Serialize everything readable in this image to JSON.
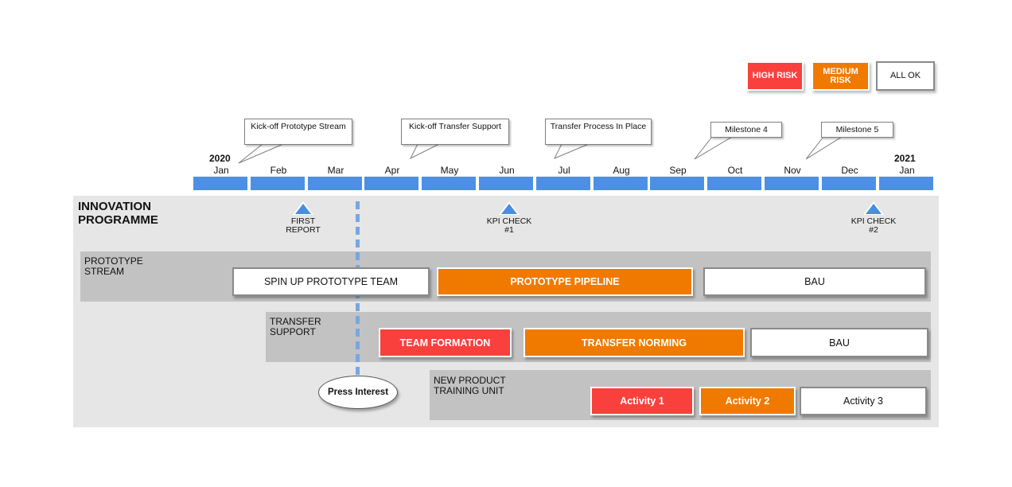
{
  "legend": {
    "high_risk": "HIGH RISK",
    "medium_risk": "MEDIUM RISK",
    "all_ok": "ALL OK",
    "colors": {
      "high": "#f9403c",
      "medium": "#f07a00",
      "ok": "#ffffff",
      "timeline": "#4f8fe3",
      "milestone": "#4a8ee0"
    }
  },
  "callouts": [
    {
      "text": "Kick-off Prototype Stream",
      "month": "Jan"
    },
    {
      "text": "Kick-off Transfer Support",
      "month": "Apr"
    },
    {
      "text": "Transfer Process In Place",
      "month": "Jul"
    },
    {
      "text": "Milestone 4",
      "month": "Sep"
    },
    {
      "text": "Milestone 5",
      "month": "Nov"
    }
  ],
  "timeline": {
    "start_year": "2020",
    "end_year": "2021",
    "months": [
      "Jan",
      "Feb",
      "Mar",
      "Apr",
      "May",
      "Jun",
      "Jul",
      "Aug",
      "Sep",
      "Oct",
      "Nov",
      "Dec",
      "Jan"
    ]
  },
  "programme": {
    "title": "INNOVATION PROGRAMME",
    "milestones": [
      {
        "label": "FIRST REPORT",
        "month": "Feb"
      },
      {
        "label": "KPI CHECK #1",
        "month": "Jun"
      },
      {
        "label": "KPI CHECK #2",
        "month": "Dec"
      }
    ],
    "event": {
      "label": "Press Interest",
      "month": "Mar"
    }
  },
  "lanes": [
    {
      "label": "PROTOTYPE STREAM",
      "tasks": [
        {
          "label": "SPIN UP PROTOTYPE TEAM",
          "status": "ok"
        },
        {
          "label": "PROTOTYPE PIPELINE",
          "status": "medium"
        },
        {
          "label": "BAU",
          "status": "ok"
        }
      ]
    },
    {
      "label": "TRANSFER SUPPORT",
      "tasks": [
        {
          "label": "TEAM FORMATION",
          "status": "high"
        },
        {
          "label": "TRANSFER NORMING",
          "status": "medium"
        },
        {
          "label": "BAU",
          "status": "ok"
        }
      ]
    },
    {
      "label": "NEW PRODUCT TRAINING UNIT",
      "tasks": [
        {
          "label": "Activity 1",
          "status": "high"
        },
        {
          "label": "Activity 2",
          "status": "medium"
        },
        {
          "label": "Activity 3",
          "status": "ok"
        }
      ]
    }
  ]
}
